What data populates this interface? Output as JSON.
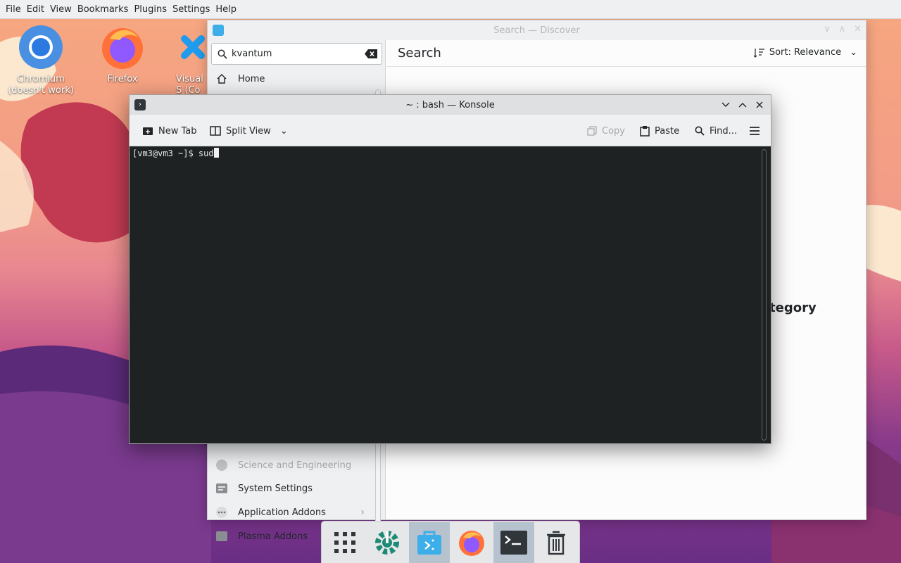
{
  "menubar": {
    "items": [
      "File",
      "Edit",
      "View",
      "Bookmarks",
      "Plugins",
      "Settings",
      "Help"
    ]
  },
  "desktop": {
    "icons": [
      {
        "label": "Chromium (doesn't work)",
        "icon": "chromium-icon"
      },
      {
        "label": "Firefox",
        "icon": "firefox-icon"
      },
      {
        "label": "Visual S (Co",
        "icon": "vscode-icon"
      }
    ]
  },
  "discover": {
    "title": "Search — Discover",
    "search_value": "kvantum",
    "header_title": "Search",
    "sort_label": "Sort: Relevance",
    "category_fragment": "tegory",
    "sidebar": {
      "home": "Home",
      "items": [
        {
          "label": "Science and Engineering",
          "chevron": true
        },
        {
          "label": "System Settings",
          "chevron": false
        },
        {
          "label": "Application Addons",
          "chevron": true
        },
        {
          "label": "Plasma Addons",
          "chevron": true
        }
      ]
    }
  },
  "konsole": {
    "title": "~ : bash — Konsole",
    "toolbar": {
      "new_tab": "New Tab",
      "split_view": "Split View",
      "copy": "Copy",
      "paste": "Paste",
      "find": "Find..."
    },
    "prompt": "[vm3@vm3 ~]$ sud"
  },
  "dock": {
    "items": [
      "app-launcher-icon",
      "system-settings-icon",
      "discover-icon",
      "firefox-icon",
      "konsole-icon",
      "trash-icon"
    ]
  },
  "colors": {
    "accent": "#3daee9",
    "terminal_bg": "#1f2222",
    "panel_bg": "#eff0f1"
  }
}
